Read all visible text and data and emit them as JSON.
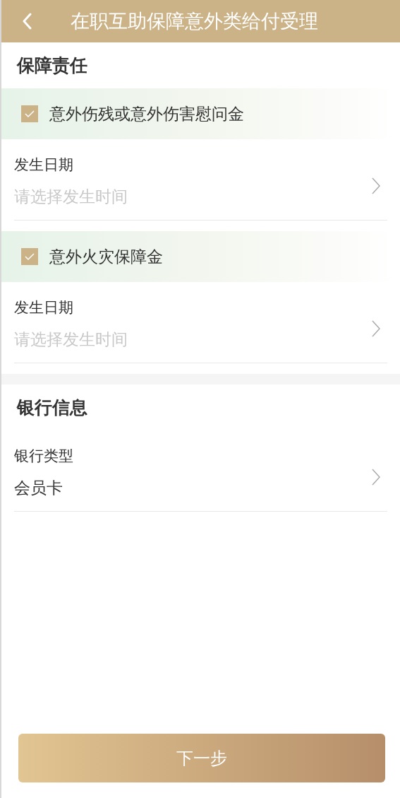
{
  "header": {
    "title": "在职互助保障意外类给付受理"
  },
  "sections": [
    {
      "title": "保障责任",
      "items": [
        {
          "kind": "checkbox",
          "label": "意外伤残或意外伤害慰问金",
          "checked": true
        },
        {
          "kind": "field",
          "label": "发生日期",
          "placeholder": "请选择发生时间"
        },
        {
          "kind": "checkbox",
          "label": "意外火灾保障金",
          "checked": true
        },
        {
          "kind": "field",
          "label": "发生日期",
          "placeholder": "请选择发生时间"
        }
      ]
    },
    {
      "title": "银行信息",
      "items": [
        {
          "kind": "field",
          "label": "银行类型",
          "value": "会员卡"
        }
      ]
    }
  ],
  "next_button": {
    "label": "下一步"
  }
}
